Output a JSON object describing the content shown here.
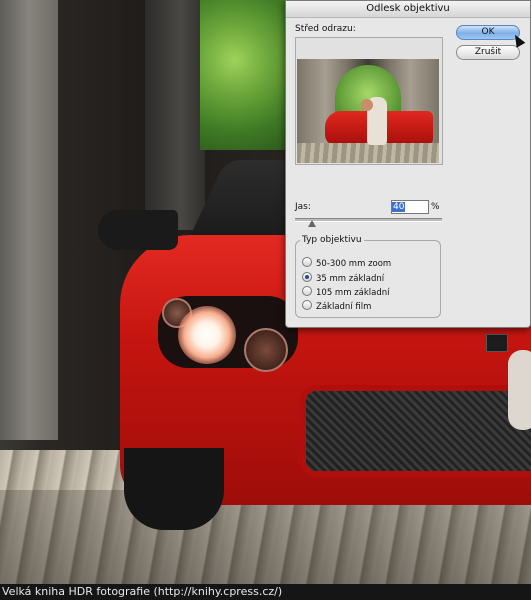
{
  "dialog": {
    "title": "Odlesk objektivu",
    "center_label": "Střed odrazu:",
    "ok_label": "OK",
    "cancel_label": "Zrušit",
    "brightness_label": "Jas:",
    "brightness_value": "40",
    "brightness_unit": "%",
    "lens_group_title": "Typ objektivu",
    "lens_options": [
      {
        "label": "50-300 mm zoom",
        "selected": false
      },
      {
        "label": "35 mm základní",
        "selected": true
      },
      {
        "label": "105 mm základní",
        "selected": false
      },
      {
        "label": "Základní film",
        "selected": false
      }
    ]
  },
  "caption": "Velká kniha HDR fotografie (http://knihy.cpress.cz/)",
  "colors": {
    "accent": "#7fb0e8",
    "car_red": "#d41a14"
  }
}
